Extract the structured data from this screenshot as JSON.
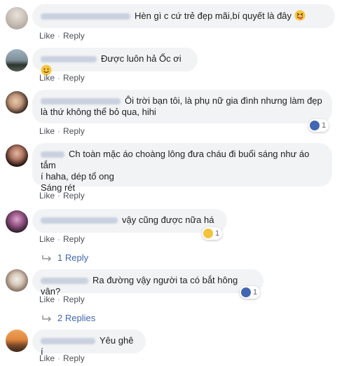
{
  "actions": {
    "like": "Like",
    "reply": "Reply",
    "separator": "·"
  },
  "comments": [
    {
      "text": "Hèn gì c cứ trẻ đẹp mãi,bí quyết là đây",
      "emoji": "squinting-tongue-emoji"
    },
    {
      "text": "Được luôn hả Ốc ơi",
      "emoji": "smile-emoji"
    },
    {
      "text_line1": "Ôi trời bạn tôi, là phụ nữ gia đình nhưng làm đẹp",
      "text_line2": "là thứ không thể bỏ qua, hihi",
      "reaction_count": "1",
      "reaction": "like-icon"
    },
    {
      "text_line1": "Ch toàn mặc áo choàng lông đưa cháu đi buổi sáng như áo tắm",
      "text_line2": "í haha, dép tổ ong",
      "text_line3": "Sáng rét"
    },
    {
      "text": "vậy cũng được nữa há",
      "reaction_count": "1",
      "reaction": "haha-icon",
      "replies": "1 Reply"
    },
    {
      "text": "Ra đường vậy người ta có bắt hông vân?",
      "reaction_count": "1",
      "reaction": "like-icon",
      "replies": "2 Replies"
    },
    {
      "text": "Yêu ghê í"
    }
  ],
  "colors": {
    "link": "#4267b2",
    "bubble": "#f2f3f5",
    "meta": "#616770"
  }
}
